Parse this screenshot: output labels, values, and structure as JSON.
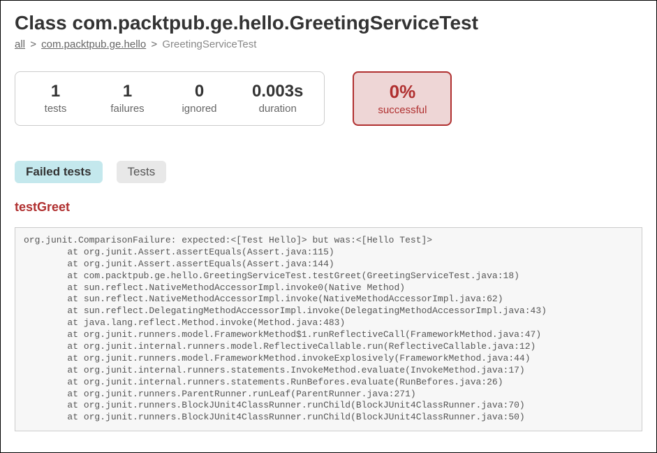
{
  "page_title": "Class com.packtpub.ge.hello.GreetingServiceTest",
  "breadcrumb": {
    "all": "all",
    "pkg": "com.packtpub.ge.hello",
    "current": "GreetingServiceTest"
  },
  "stats": {
    "tests": {
      "value": "1",
      "label": "tests"
    },
    "failures": {
      "value": "1",
      "label": "failures"
    },
    "ignored": {
      "value": "0",
      "label": "ignored"
    },
    "duration": {
      "value": "0.003s",
      "label": "duration"
    }
  },
  "success": {
    "value": "0%",
    "label": "successful"
  },
  "tabs": {
    "failed": "Failed tests",
    "tests": "Tests"
  },
  "failed_test_name": "testGreet",
  "stack_trace": "org.junit.ComparisonFailure: expected:<[Test Hello]> but was:<[Hello Test]>\n        at org.junit.Assert.assertEquals(Assert.java:115)\n        at org.junit.Assert.assertEquals(Assert.java:144)\n        at com.packtpub.ge.hello.GreetingServiceTest.testGreet(GreetingServiceTest.java:18)\n        at sun.reflect.NativeMethodAccessorImpl.invoke0(Native Method)\n        at sun.reflect.NativeMethodAccessorImpl.invoke(NativeMethodAccessorImpl.java:62)\n        at sun.reflect.DelegatingMethodAccessorImpl.invoke(DelegatingMethodAccessorImpl.java:43)\n        at java.lang.reflect.Method.invoke(Method.java:483)\n        at org.junit.runners.model.FrameworkMethod$1.runReflectiveCall(FrameworkMethod.java:47)\n        at org.junit.internal.runners.model.ReflectiveCallable.run(ReflectiveCallable.java:12)\n        at org.junit.runners.model.FrameworkMethod.invokeExplosively(FrameworkMethod.java:44)\n        at org.junit.internal.runners.statements.InvokeMethod.evaluate(InvokeMethod.java:17)\n        at org.junit.internal.runners.statements.RunBefores.evaluate(RunBefores.java:26)\n        at org.junit.runners.ParentRunner.runLeaf(ParentRunner.java:271)\n        at org.junit.runners.BlockJUnit4ClassRunner.runChild(BlockJUnit4ClassRunner.java:70)\n        at org.junit.runners.BlockJUnit4ClassRunner.runChild(BlockJUnit4ClassRunner.java:50)"
}
